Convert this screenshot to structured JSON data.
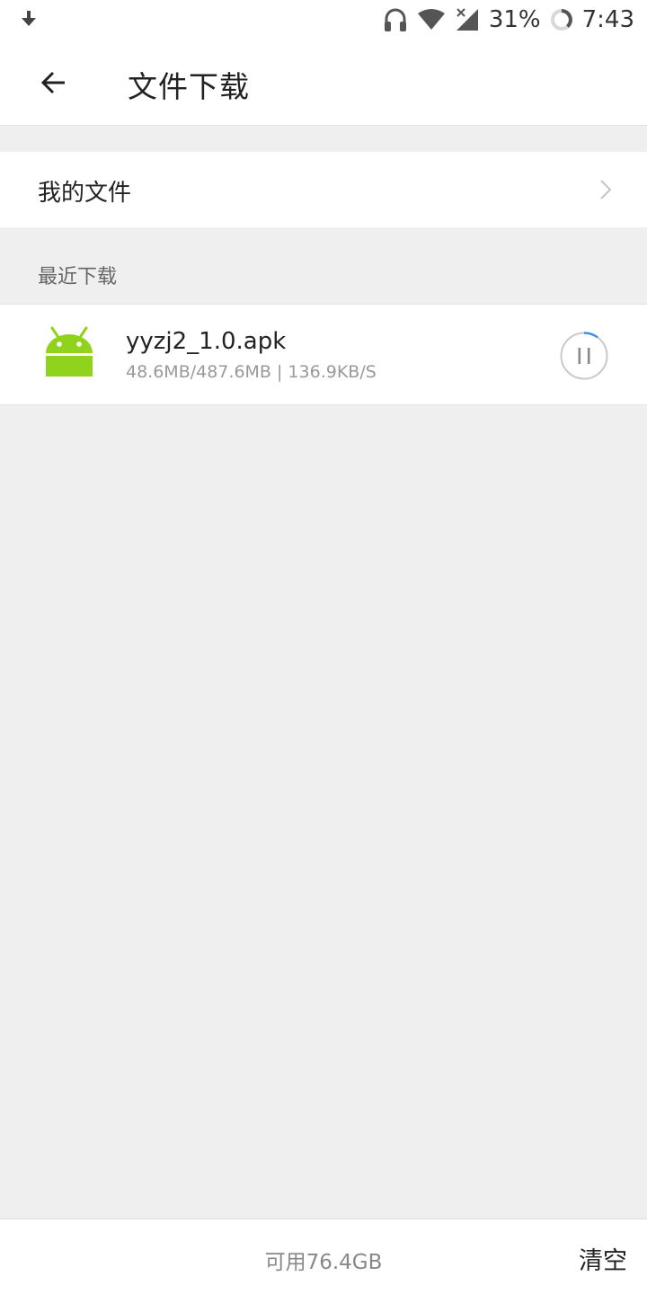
{
  "status_bar": {
    "battery_percent": "31%",
    "time": "7:43",
    "icons": [
      "download-arrow-icon",
      "headphones-icon",
      "wifi-icon",
      "signal-icon",
      "battery-icon"
    ]
  },
  "header": {
    "back_icon": "arrow-left-icon",
    "title": "文件下载"
  },
  "my_files": {
    "label": "我的文件",
    "chevron_icon": "chevron-right-icon"
  },
  "recent": {
    "section_title": "最近下载",
    "items": [
      {
        "icon": "android-icon",
        "file_name": "yyzj2_1.0.apk",
        "meta": "48.6MB/487.6MB | 136.9KB/S",
        "progress": 0.0997,
        "action_icon": "pause-icon"
      }
    ]
  },
  "footer": {
    "storage_label": "可用76.4GB",
    "clear_label": "清空"
  },
  "colors": {
    "android_green": "#8fd31c",
    "progress_blue": "#3d8fe6",
    "background": "#efefef"
  }
}
